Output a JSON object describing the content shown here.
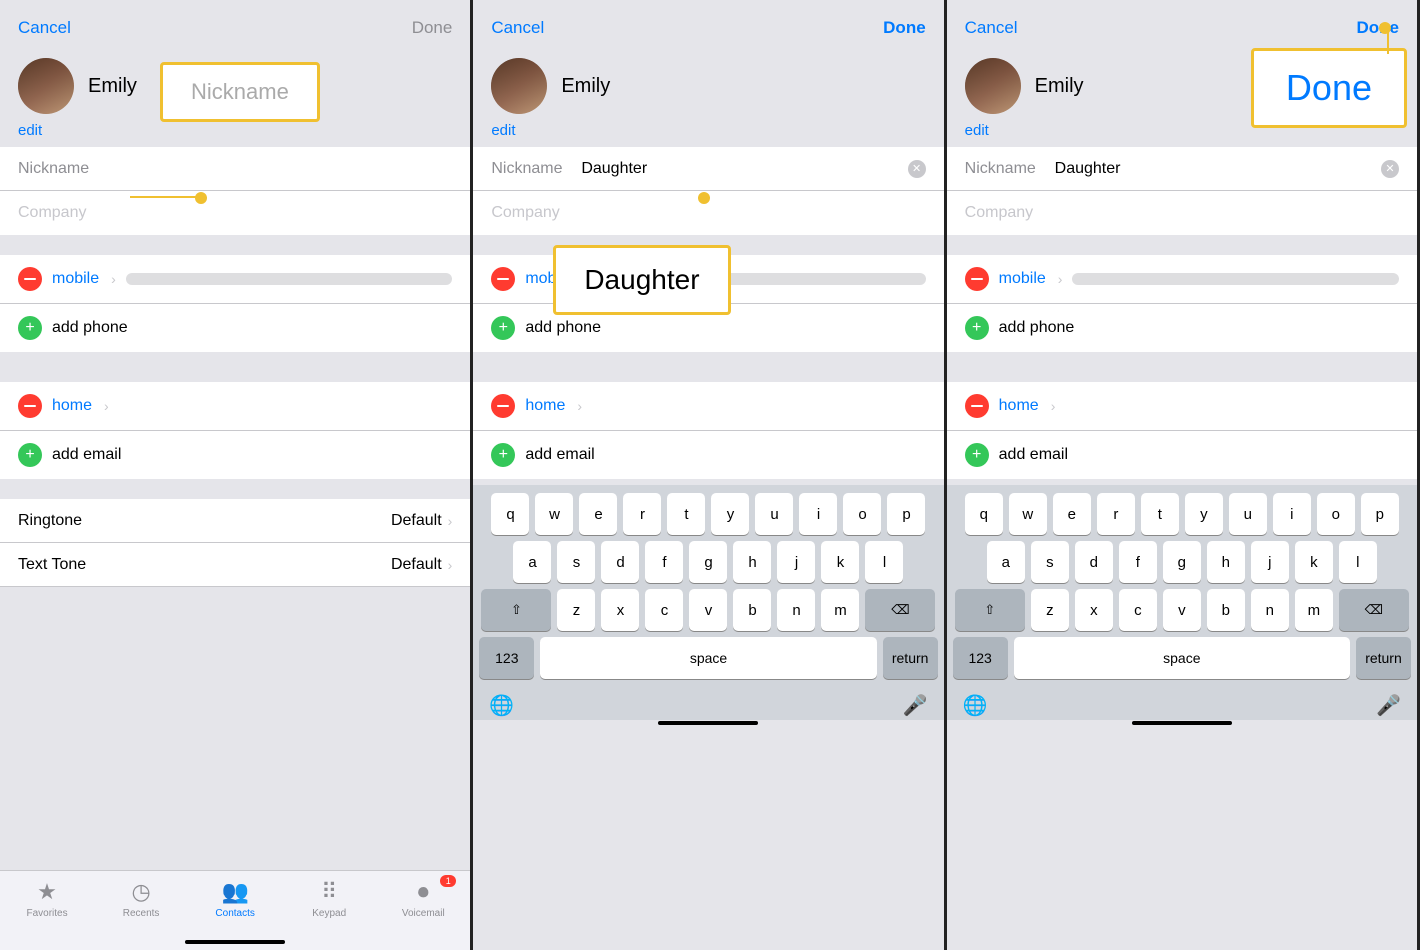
{
  "panels": [
    {
      "id": "panel1",
      "top_bar": {
        "cancel": "Cancel",
        "done": "Done",
        "done_color": "gray"
      },
      "contact": {
        "name": "Emily"
      },
      "edit_link": "edit",
      "fields": [
        {
          "label": "Nickname",
          "value": "",
          "placeholder": ""
        },
        {
          "label": "Company",
          "value": "",
          "placeholder": ""
        }
      ],
      "phone_rows": [
        {
          "type": "remove",
          "label": "mobile",
          "has_value": true
        },
        {
          "type": "add",
          "label": "add phone"
        }
      ],
      "email_rows": [
        {
          "type": "remove",
          "label": "home",
          "has_value": false
        },
        {
          "type": "add",
          "label": "add email"
        }
      ],
      "settings": [
        {
          "label": "Ringtone",
          "value": "Default"
        },
        {
          "label": "Text Tone",
          "value": "Default"
        }
      ],
      "callout": {
        "text": "Nickname",
        "type": "nickname_field"
      },
      "show_keyboard": false,
      "tab_bar": {
        "items": [
          {
            "label": "Favorites",
            "icon": "★",
            "active": false
          },
          {
            "label": "Recents",
            "icon": "🕐",
            "active": false
          },
          {
            "label": "Contacts",
            "icon": "👥",
            "active": true
          },
          {
            "label": "Keypad",
            "icon": "⠿",
            "active": false
          },
          {
            "label": "Voicemail",
            "icon": "⏺",
            "active": false,
            "badge": "1"
          }
        ]
      }
    },
    {
      "id": "panel2",
      "top_bar": {
        "cancel": "Cancel",
        "done": "Done",
        "done_color": "blue"
      },
      "contact": {
        "name": "Emily"
      },
      "edit_link": "edit",
      "fields": [
        {
          "label": "Nickname",
          "value": "Daughter",
          "placeholder": ""
        },
        {
          "label": "Company",
          "value": "",
          "placeholder": ""
        }
      ],
      "phone_rows": [
        {
          "type": "remove",
          "label": "mobile",
          "has_value": true
        },
        {
          "type": "add",
          "label": "add phone"
        }
      ],
      "email_rows": [
        {
          "type": "remove",
          "label": "home",
          "has_value": false
        },
        {
          "type": "add",
          "label": "add email"
        }
      ],
      "callout": {
        "text": "Daughter",
        "type": "daughter_field"
      },
      "show_keyboard": true,
      "keyboard": {
        "rows": [
          [
            "q",
            "w",
            "e",
            "r",
            "t",
            "y",
            "u",
            "i",
            "o",
            "p"
          ],
          [
            "a",
            "s",
            "d",
            "f",
            "g",
            "h",
            "j",
            "k",
            "l"
          ],
          [
            "⇧",
            "z",
            "x",
            "c",
            "v",
            "b",
            "n",
            "m",
            "⌫"
          ],
          [
            "123",
            "space",
            "return"
          ]
        ]
      }
    },
    {
      "id": "panel3",
      "top_bar": {
        "cancel": "Cancel",
        "done": "Done",
        "done_color": "blue"
      },
      "contact": {
        "name": "Emily"
      },
      "edit_link": "edit",
      "fields": [
        {
          "label": "Nickname",
          "value": "Daughter",
          "placeholder": ""
        },
        {
          "label": "Company",
          "value": "",
          "placeholder": ""
        }
      ],
      "phone_rows": [
        {
          "type": "remove",
          "label": "mobile",
          "has_value": true
        },
        {
          "type": "add",
          "label": "add phone"
        }
      ],
      "email_rows": [
        {
          "type": "remove",
          "label": "home",
          "has_value": false
        },
        {
          "type": "add",
          "label": "add email"
        }
      ],
      "callout": {
        "text": "Done",
        "type": "done_button"
      },
      "show_keyboard": true,
      "keyboard": {
        "rows": [
          [
            "q",
            "w",
            "e",
            "r",
            "t",
            "y",
            "u",
            "i",
            "o",
            "p"
          ],
          [
            "a",
            "s",
            "d",
            "f",
            "g",
            "h",
            "j",
            "k",
            "l"
          ],
          [
            "⇧",
            "z",
            "x",
            "c",
            "v",
            "b",
            "n",
            "m",
            "⌫"
          ],
          [
            "123",
            "space",
            "return"
          ]
        ]
      }
    }
  ],
  "icons": {
    "star": "★",
    "recents": "◷",
    "contacts": "👥",
    "keypad": "⠿",
    "voicemail": "⏺",
    "globe": "🌐",
    "mic": "🎤"
  }
}
